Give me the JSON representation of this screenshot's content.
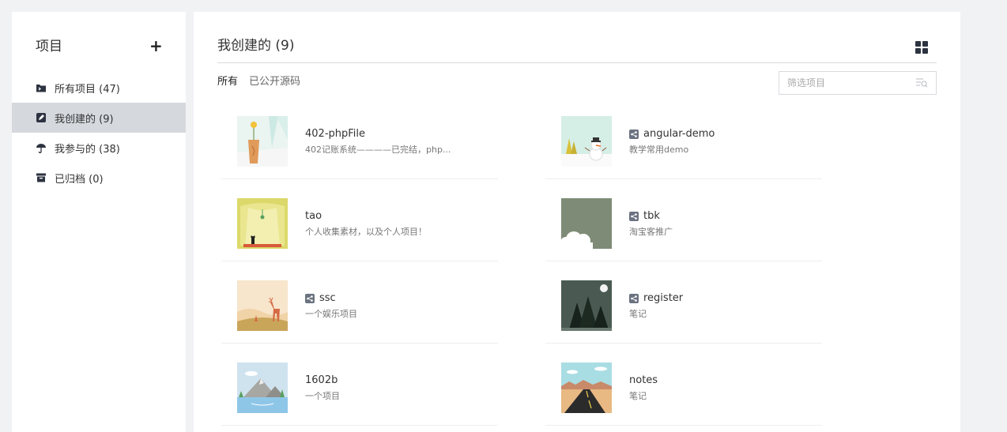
{
  "sidebar": {
    "title": "项目",
    "add_label": "+",
    "items": [
      {
        "label": "所有项目 (47)",
        "icon": "folder-icon"
      },
      {
        "label": "我创建的 (9)",
        "icon": "edit-icon"
      },
      {
        "label": "我参与的 (38)",
        "icon": "umbrella-icon"
      },
      {
        "label": "已归档 (0)",
        "icon": "archive-icon"
      }
    ]
  },
  "main": {
    "title": "我创建的 (9)",
    "tabs": [
      {
        "label": "所有"
      },
      {
        "label": "已公开源码"
      }
    ],
    "filter_placeholder": "筛选项目",
    "projects": [
      {
        "name": "402-phpFile",
        "desc": "402记账系统————已完结，php...",
        "shared": false,
        "thumb": "sunflower-vase"
      },
      {
        "name": "angular-demo",
        "desc": "教学常用demo",
        "shared": true,
        "thumb": "snowman"
      },
      {
        "name": "tao",
        "desc": "个人收集素材，以及个人项目！",
        "shared": false,
        "thumb": "cat-in-tent"
      },
      {
        "name": "tbk",
        "desc": "淘宝客推广",
        "shared": true,
        "thumb": "moon-clouds"
      },
      {
        "name": "ssc",
        "desc": "一个娱乐项目",
        "shared": true,
        "thumb": "deer"
      },
      {
        "name": "register",
        "desc": "笔记",
        "shared": true,
        "thumb": "pine-trees"
      },
      {
        "name": "1602b",
        "desc": "一个项目",
        "shared": false,
        "thumb": "mountain-lake"
      },
      {
        "name": "notes",
        "desc": "笔记",
        "shared": false,
        "thumb": "desert-road"
      }
    ]
  }
}
